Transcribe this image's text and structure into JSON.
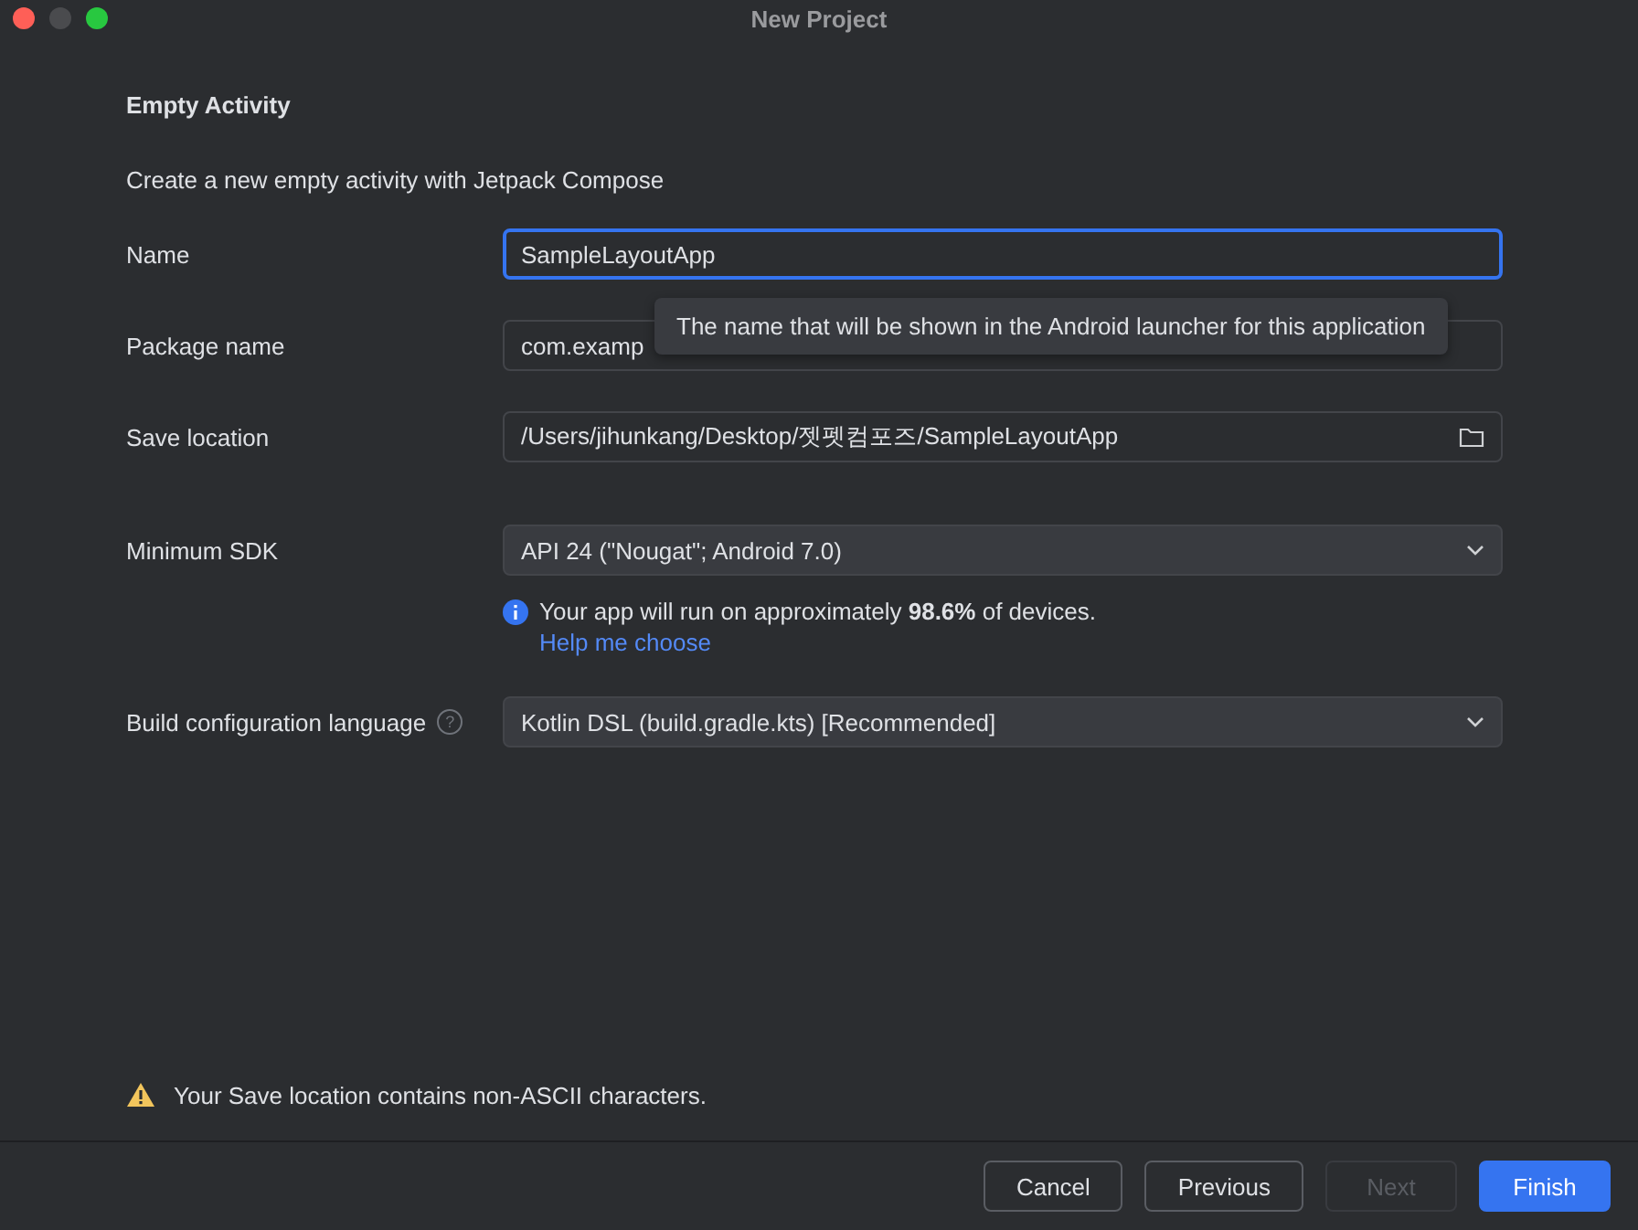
{
  "window": {
    "title": "New Project"
  },
  "heading": "Empty Activity",
  "description": "Create a new empty activity with Jetpack Compose",
  "fields": [
    {
      "label": "Name",
      "kind": "text",
      "value": "SampleLayoutApp",
      "focused": true
    },
    {
      "label": "Package name",
      "kind": "text",
      "value": "com.examp",
      "focused": false
    },
    {
      "label": "Save location",
      "kind": "folder",
      "value": "/Users/jihunkang/Desktop/젯펫컴포즈/SampleLayoutApp",
      "focused": false
    },
    {
      "label": "Minimum SDK",
      "kind": "dropdown",
      "value": "API 24 (\"Nougat\"; Android 7.0)",
      "focused": false,
      "info": "Your app will run on approximately **98.6%** of devices.",
      "link": "Help me choose"
    },
    {
      "label": "Build configuration language",
      "kind": "dropdown",
      "value": "Kotlin DSL (build.gradle.kts) [Recommended]",
      "focused": false,
      "help": "?"
    }
  ],
  "tooltip": "The name that will be shown in the Android launcher for this application",
  "warning": "Your Save location contains non-ASCII characters.",
  "buttons": [
    {
      "label": "Cancel",
      "kind": "secondary",
      "disabled": false
    },
    {
      "label": "Previous",
      "kind": "secondary",
      "disabled": false
    },
    {
      "label": "Next",
      "kind": "secondary",
      "disabled": true
    },
    {
      "label": "Finish",
      "kind": "primary",
      "disabled": false
    }
  ]
}
